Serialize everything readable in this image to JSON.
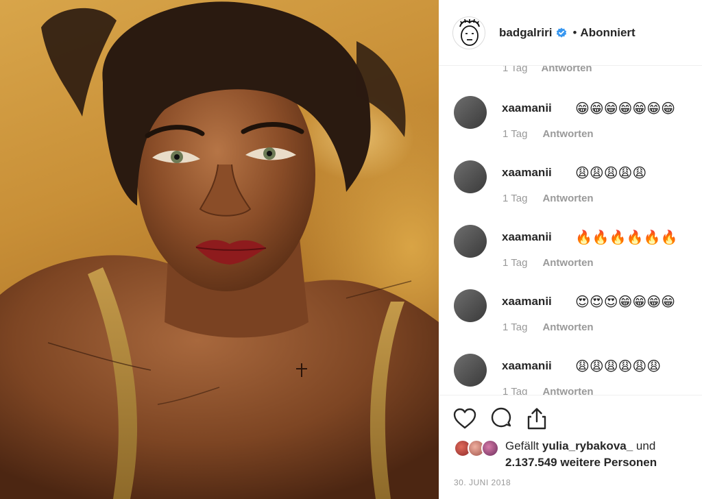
{
  "post": {
    "username": "badgalriri",
    "separator": "•",
    "follow_status": "Abonniert"
  },
  "partial_comment": {
    "time": "1 Tag",
    "reply_label": "Antworten"
  },
  "comments": [
    {
      "user": "xaamanii",
      "text": "😁😁😁😁😁😁😁",
      "time": "1 Tag",
      "reply_label": "Antworten"
    },
    {
      "user": "xaamanii",
      "text": "😩😩😩😩😩",
      "time": "1 Tag",
      "reply_label": "Antworten"
    },
    {
      "user": "xaamanii",
      "text": "🔥🔥🔥🔥🔥🔥",
      "time": "1 Tag",
      "reply_label": "Antworten"
    },
    {
      "user": "xaamanii",
      "text": "😍😍😍😁😁😁😁",
      "time": "1 Tag",
      "reply_label": "Antworten"
    },
    {
      "user": "xaamanii",
      "text": "😩😩😩😩😩😩",
      "time": "1 Tag",
      "reply_label": "Antworten"
    }
  ],
  "likes": {
    "prefix": "Gefällt",
    "user": "yulia_rybakova_",
    "conjunction": "und",
    "count": "2.137.549 weitere Personen"
  },
  "date": "30. JUNI 2018",
  "icons": {
    "like": "heart-icon",
    "comment": "comment-bubble-icon",
    "share": "share-icon",
    "verified": "verified-badge-icon"
  },
  "colors": {
    "verified_blue": "#3897f0",
    "meta_gray": "#999999",
    "text": "#262626"
  }
}
